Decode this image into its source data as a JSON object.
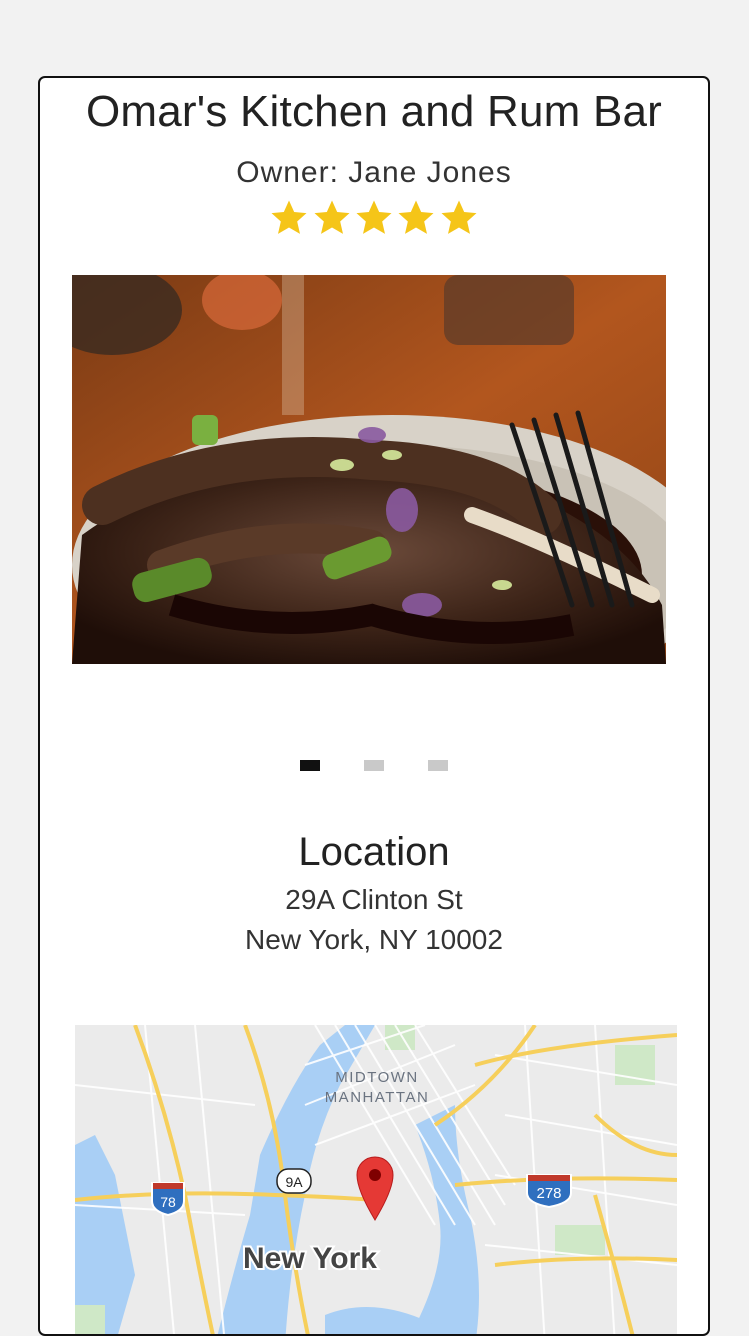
{
  "restaurant": {
    "name": "Omar's Kitchen and Rum Bar",
    "owner": "Owner: Jane Jones",
    "rating": 5,
    "rating_max": 5,
    "star_color": "#f5c518"
  },
  "carousel": {
    "photo_icon": "food-photo",
    "slide_count": 3,
    "active_index": 0
  },
  "location": {
    "heading": "Location",
    "address_line1": "29A Clinton St",
    "address_line2": "New York, NY 10002"
  },
  "map": {
    "district_line1": "MIDTOWN",
    "district_line2": "MANHATTAN",
    "city_label": "New York",
    "shield_78": "78",
    "shield_9a": "9A",
    "shield_278": "278",
    "pin_color": "#e53935"
  }
}
